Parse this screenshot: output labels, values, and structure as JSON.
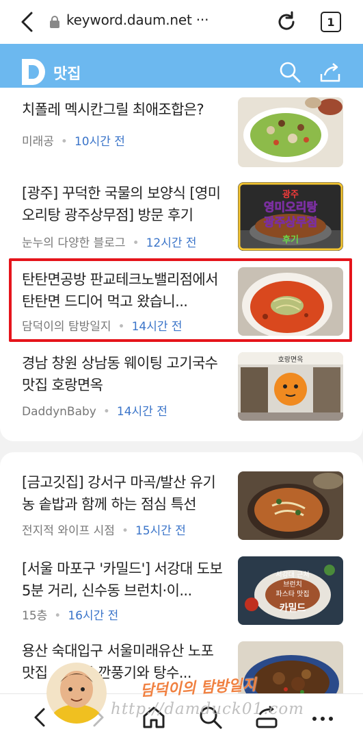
{
  "browser": {
    "url": "keyword.daum.net ···",
    "tab_count": "1"
  },
  "header": {
    "title": "맛집"
  },
  "section1": {
    "items": [
      {
        "title": "치폴레 멕시칸그릴 최애조합은?",
        "source": "미래공",
        "time": "10시간 전"
      },
      {
        "title": "[광주] 꾸덕한 국물의 보양식 [영미오리탕 광주상무점] 방문 후기",
        "source": "눈누의 다양한 블로그",
        "time": "12시간 전",
        "thumb_text": "광주 영미오리탕 광주상무점 후기"
      },
      {
        "title": "탄탄면공방 판교테크노밸리점에서 탄탄면 드디어 먹고 왔습니...",
        "source": "담덕이의 탐방일지",
        "time": "14시간 전"
      },
      {
        "title": "경남 창원 상남동 웨이팅 고기국수 맛집 호랑면옥",
        "source": "DaddynBaby",
        "time": "14시간 전",
        "thumb_text": "호랑면옥"
      }
    ]
  },
  "section2": {
    "items": [
      {
        "title": "[금고깃집] 강서구 마곡/발산 유기농 솥밥과 함께 하는 점심 특선",
        "source": "전지적 와이프 시점",
        "time": "15시간 전"
      },
      {
        "title": "[서울 마포구 '카밀드'] 서강대 도보 5분 거리, 신수동 브런치·이...",
        "source": "15층",
        "time": "16시간 전",
        "thumb_text": "서강대 근처 브런치 파스타 맛집 카밀드"
      },
      {
        "title": "용산 숙대입구 서울미래유산 노포 맛집 ... 수루 깐풍기와 탕수...",
        "source": "",
        "time": ""
      }
    ]
  },
  "watermark": {
    "name": "담덕이의 탐방일지",
    "url": "http://damduck01.com"
  },
  "colors": {
    "header_bg": "#6cb8ef",
    "time_text": "#3a74c9",
    "highlight": "#e5141b"
  }
}
